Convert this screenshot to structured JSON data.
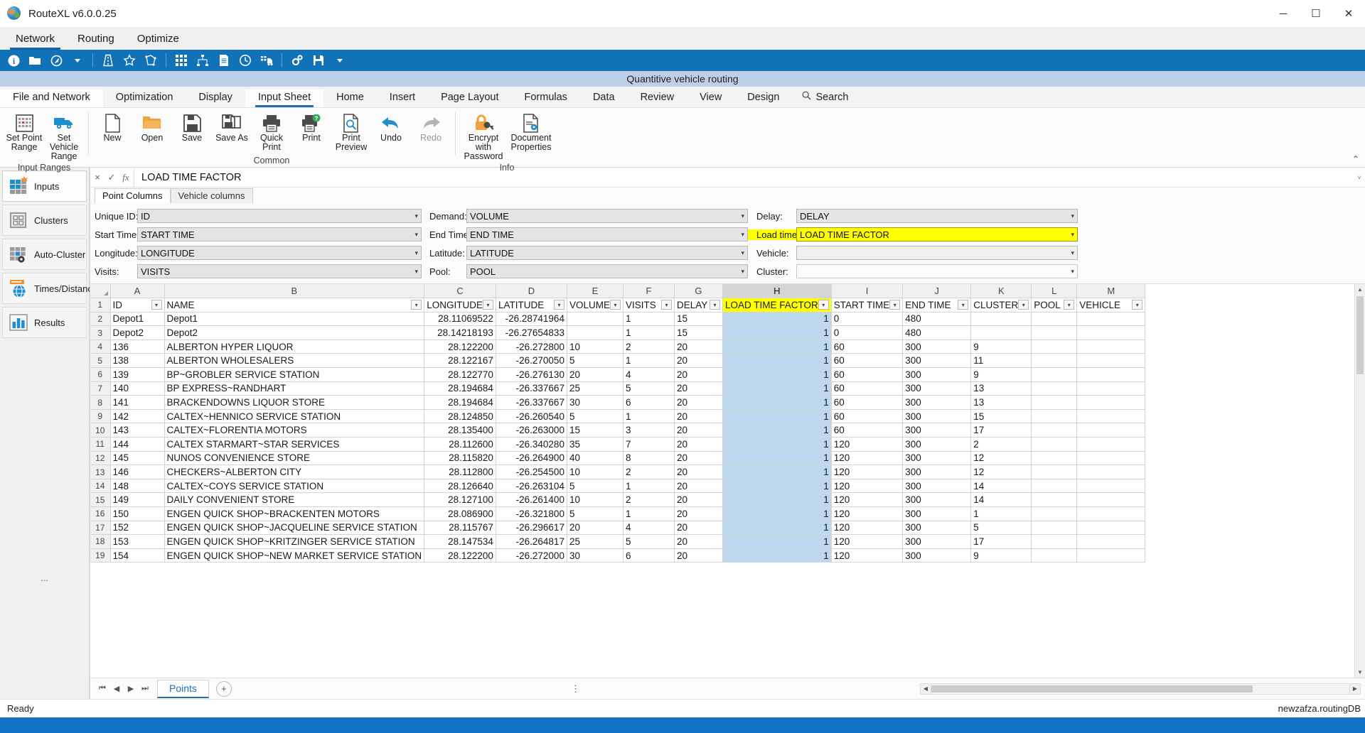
{
  "titlebar": {
    "app_title": "RouteXL v6.0.0.25",
    "minimize": "─",
    "maximize": "☐",
    "close": "✕"
  },
  "menubar": {
    "items": [
      {
        "label": "Network",
        "active": true
      },
      {
        "label": "Routing",
        "active": false
      },
      {
        "label": "Optimize",
        "active": false
      }
    ]
  },
  "toolbar": {
    "icons": [
      "info-icon",
      "folder-icon",
      "compass-icon",
      "chevron-down-icon",
      "sep",
      "road-icon",
      "star-icon",
      "polygon-icon",
      "sep",
      "grid-matrix-icon",
      "network-nodes-icon",
      "document-list-icon",
      "clock-icon",
      "truck-list-icon",
      "sep",
      "settings-gears-icon",
      "save-disk-icon",
      "chevron-down-icon"
    ]
  },
  "doc_band": {
    "title": "Quantitive vehicle routing"
  },
  "ribbon_tabs": {
    "items": [
      {
        "label": "File and Network",
        "selected": false,
        "white": true
      },
      {
        "label": "Optimization",
        "selected": false
      },
      {
        "label": "Display",
        "selected": false
      },
      {
        "label": "Input Sheet",
        "selected": true
      },
      {
        "label": "Home",
        "selected": false
      },
      {
        "label": "Insert",
        "selected": false
      },
      {
        "label": "Page Layout",
        "selected": false
      },
      {
        "label": "Formulas",
        "selected": false
      },
      {
        "label": "Data",
        "selected": false
      },
      {
        "label": "Review",
        "selected": false
      },
      {
        "label": "View",
        "selected": false
      },
      {
        "label": "Design",
        "selected": false
      }
    ],
    "search_label": "Search"
  },
  "ribbon": {
    "groups": [
      {
        "label": "Input Ranges",
        "buttons": [
          {
            "name": "set-point-range",
            "label": "Set Point\nRange",
            "icon": "point-grid-icon"
          },
          {
            "name": "set-vehicle-range",
            "label": "Set Vehicle\nRange",
            "icon": "truck-icon"
          }
        ]
      },
      {
        "label": "Common",
        "buttons": [
          {
            "name": "new",
            "label": "New",
            "icon": "new-document-icon"
          },
          {
            "name": "open",
            "label": "Open",
            "icon": "open-folder-icon"
          },
          {
            "name": "save",
            "label": "Save",
            "icon": "save-disk-icon"
          },
          {
            "name": "save-as",
            "label": "Save As",
            "icon": "save-as-icon"
          },
          {
            "name": "quick-print",
            "label": "Quick\nPrint",
            "icon": "printer-icon"
          },
          {
            "name": "print",
            "label": "Print",
            "icon": "printer-help-icon"
          },
          {
            "name": "print-preview",
            "label": "Print\nPreview",
            "icon": "print-preview-icon"
          },
          {
            "name": "undo",
            "label": "Undo",
            "icon": "undo-arrow-icon"
          },
          {
            "name": "redo",
            "label": "Redo",
            "icon": "redo-arrow-icon",
            "disabled": true
          }
        ]
      },
      {
        "label": "Info",
        "buttons": [
          {
            "name": "encrypt-with-password",
            "label": "Encrypt with\nPassword",
            "icon": "lock-key-icon"
          },
          {
            "name": "document-properties",
            "label": "Document\nProperties",
            "icon": "document-properties-icon"
          }
        ]
      }
    ],
    "collapse_label": "⌃"
  },
  "sidebar": {
    "items": [
      {
        "label": "Inputs",
        "icon": "inputs-grid-icon",
        "selected": true
      },
      {
        "label": "Clusters",
        "icon": "clusters-grid-icon",
        "selected": false
      },
      {
        "label": "Auto-Cluster",
        "icon": "auto-cluster-icon",
        "selected": false
      },
      {
        "label": "Times/Distances",
        "icon": "globe-book-icon",
        "selected": false
      },
      {
        "label": "Results",
        "icon": "results-chart-icon",
        "selected": false
      }
    ],
    "footer": "..."
  },
  "formula_bar": {
    "cancel": "×",
    "accept": "✓",
    "fx": "fx",
    "value": "LOAD TIME FACTOR",
    "expand": "˅"
  },
  "column_tabs": [
    {
      "label": "Point Columns",
      "selected": true
    },
    {
      "label": "Vehicle columns",
      "selected": false
    }
  ],
  "fields": [
    {
      "label": "Unique ID:",
      "value": "ID",
      "name": "unique-id",
      "highlight": false,
      "empty": false
    },
    {
      "label": "Demand:",
      "value": "VOLUME",
      "name": "demand",
      "highlight": false,
      "empty": false
    },
    {
      "label": "Delay:",
      "value": "DELAY",
      "name": "delay",
      "highlight": false,
      "empty": false
    },
    {
      "label": "Start Time:",
      "value": "START TIME",
      "name": "start-time",
      "highlight": false,
      "empty": false
    },
    {
      "label": "End Time:",
      "value": "END TIME",
      "name": "end-time",
      "highlight": false,
      "empty": false
    },
    {
      "label": "Load time factor:",
      "value": "LOAD TIME FACTOR",
      "name": "load-time-factor",
      "highlight": true,
      "empty": false
    },
    {
      "label": "Longitude:",
      "value": "LONGITUDE",
      "name": "longitude",
      "highlight": false,
      "empty": false
    },
    {
      "label": "Latitude:",
      "value": "LATITUDE",
      "name": "latitude",
      "highlight": false,
      "empty": false
    },
    {
      "label": "Vehicle:",
      "value": "",
      "name": "vehicle",
      "highlight": false,
      "empty": true
    },
    {
      "label": "Visits:",
      "value": "VISITS",
      "name": "visits",
      "highlight": false,
      "empty": false
    },
    {
      "label": "Pool:",
      "value": "POOL",
      "name": "pool",
      "highlight": false,
      "empty": false
    },
    {
      "label": "Cluster:",
      "value": "",
      "name": "cluster",
      "highlight": false,
      "empty": true
    }
  ],
  "sheet": {
    "column_letters": [
      "A",
      "B",
      "C",
      "D",
      "E",
      "F",
      "G",
      "H",
      "I",
      "J",
      "K",
      "L",
      "M"
    ],
    "selected_column": "H",
    "header_row_number": "1",
    "headers": [
      "ID",
      "NAME",
      "LONGITUDE",
      "LATITUDE",
      "VOLUME",
      "VISITS",
      "DELAY",
      "LOAD TIME FACTOR",
      "START TIME",
      "END TIME",
      "CLUSTER",
      "POOL",
      "VEHICLE"
    ],
    "filter_columns": [
      0,
      1,
      2,
      3,
      4,
      5,
      6,
      7,
      8,
      9,
      10,
      11,
      12
    ],
    "rows": [
      {
        "n": "2",
        "cells": [
          "Depot1",
          "Depot1",
          "28.11069522",
          "-26.28741964",
          "",
          "1",
          "15",
          "1",
          "0",
          "480",
          "",
          "",
          ""
        ]
      },
      {
        "n": "3",
        "cells": [
          "Depot2",
          "Depot2",
          "28.14218193",
          "-26.27654833",
          "",
          "1",
          "15",
          "1",
          "0",
          "480",
          "",
          "",
          ""
        ]
      },
      {
        "n": "4",
        "cells": [
          "136",
          "ALBERTON HYPER LIQUOR",
          "28.122200",
          "-26.272800",
          "10",
          "2",
          "20",
          "1",
          "60",
          "300",
          "9",
          "",
          ""
        ]
      },
      {
        "n": "5",
        "cells": [
          "138",
          "ALBERTON WHOLESALERS",
          "28.122167",
          "-26.270050",
          "5",
          "1",
          "20",
          "1",
          "60",
          "300",
          "11",
          "",
          ""
        ]
      },
      {
        "n": "6",
        "cells": [
          "139",
          "BP~GROBLER SERVICE STATION",
          "28.122770",
          "-26.276130",
          "20",
          "4",
          "20",
          "1",
          "60",
          "300",
          "9",
          "",
          ""
        ]
      },
      {
        "n": "7",
        "cells": [
          "140",
          "BP EXPRESS~RANDHART",
          "28.194684",
          "-26.337667",
          "25",
          "5",
          "20",
          "1",
          "60",
          "300",
          "13",
          "",
          ""
        ]
      },
      {
        "n": "8",
        "cells": [
          "141",
          "BRACKENDOWNS LIQUOR STORE",
          "28.194684",
          "-26.337667",
          "30",
          "6",
          "20",
          "1",
          "60",
          "300",
          "13",
          "",
          ""
        ]
      },
      {
        "n": "9",
        "cells": [
          "142",
          "CALTEX~HENNICO SERVICE STATION",
          "28.124850",
          "-26.260540",
          "5",
          "1",
          "20",
          "1",
          "60",
          "300",
          "15",
          "",
          ""
        ]
      },
      {
        "n": "10",
        "cells": [
          "143",
          "CALTEX~FLORENTIA MOTORS",
          "28.135400",
          "-26.263000",
          "15",
          "3",
          "20",
          "1",
          "60",
          "300",
          "17",
          "",
          ""
        ]
      },
      {
        "n": "11",
        "cells": [
          "144",
          "CALTEX STARMART~STAR SERVICES",
          "28.112600",
          "-26.340280",
          "35",
          "7",
          "20",
          "1",
          "120",
          "300",
          "2",
          "",
          ""
        ]
      },
      {
        "n": "12",
        "cells": [
          "145",
          "NUNOS CONVENIENCE STORE",
          "28.115820",
          "-26.264900",
          "40",
          "8",
          "20",
          "1",
          "120",
          "300",
          "12",
          "",
          ""
        ]
      },
      {
        "n": "13",
        "cells": [
          "146",
          "CHECKERS~ALBERTON CITY",
          "28.112800",
          "-26.254500",
          "10",
          "2",
          "20",
          "1",
          "120",
          "300",
          "12",
          "",
          ""
        ]
      },
      {
        "n": "14",
        "cells": [
          "148",
          "CALTEX~COYS SERVICE STATION",
          "28.126640",
          "-26.263104",
          "5",
          "1",
          "20",
          "1",
          "120",
          "300",
          "14",
          "",
          ""
        ]
      },
      {
        "n": "15",
        "cells": [
          "149",
          "DAILY CONVENIENT STORE",
          "28.127100",
          "-26.261400",
          "10",
          "2",
          "20",
          "1",
          "120",
          "300",
          "14",
          "",
          ""
        ]
      },
      {
        "n": "16",
        "cells": [
          "150",
          "ENGEN QUICK SHOP~BRACKENTEN MOTORS",
          "28.086900",
          "-26.321800",
          "5",
          "1",
          "20",
          "1",
          "120",
          "300",
          "1",
          "",
          ""
        ]
      },
      {
        "n": "17",
        "cells": [
          "152",
          "ENGEN QUICK SHOP~JACQUELINE SERVICE STATION",
          "28.115767",
          "-26.296617",
          "20",
          "4",
          "20",
          "1",
          "120",
          "300",
          "5",
          "",
          ""
        ]
      },
      {
        "n": "18",
        "cells": [
          "153",
          "ENGEN QUICK SHOP~KRITZINGER SERVICE STATION",
          "28.147534",
          "-26.264817",
          "25",
          "5",
          "20",
          "1",
          "120",
          "300",
          "17",
          "",
          ""
        ]
      },
      {
        "n": "19",
        "cells": [
          "154",
          "ENGEN QUICK SHOP~NEW MARKET SERVICE STATION",
          "28.122200",
          "-26.272000",
          "30",
          "6",
          "20",
          "1",
          "120",
          "300",
          "9",
          "",
          ""
        ]
      }
    ]
  },
  "sheet_bar": {
    "nav": [
      "⏮",
      "◀",
      "▶",
      "⏭"
    ],
    "tab": "Points",
    "add": "+",
    "dots": "⋮",
    "left_arrow": "◀",
    "right_arrow": "▶"
  },
  "statusbar": {
    "left": "Ready",
    "right": "newzafza.routingDB"
  }
}
